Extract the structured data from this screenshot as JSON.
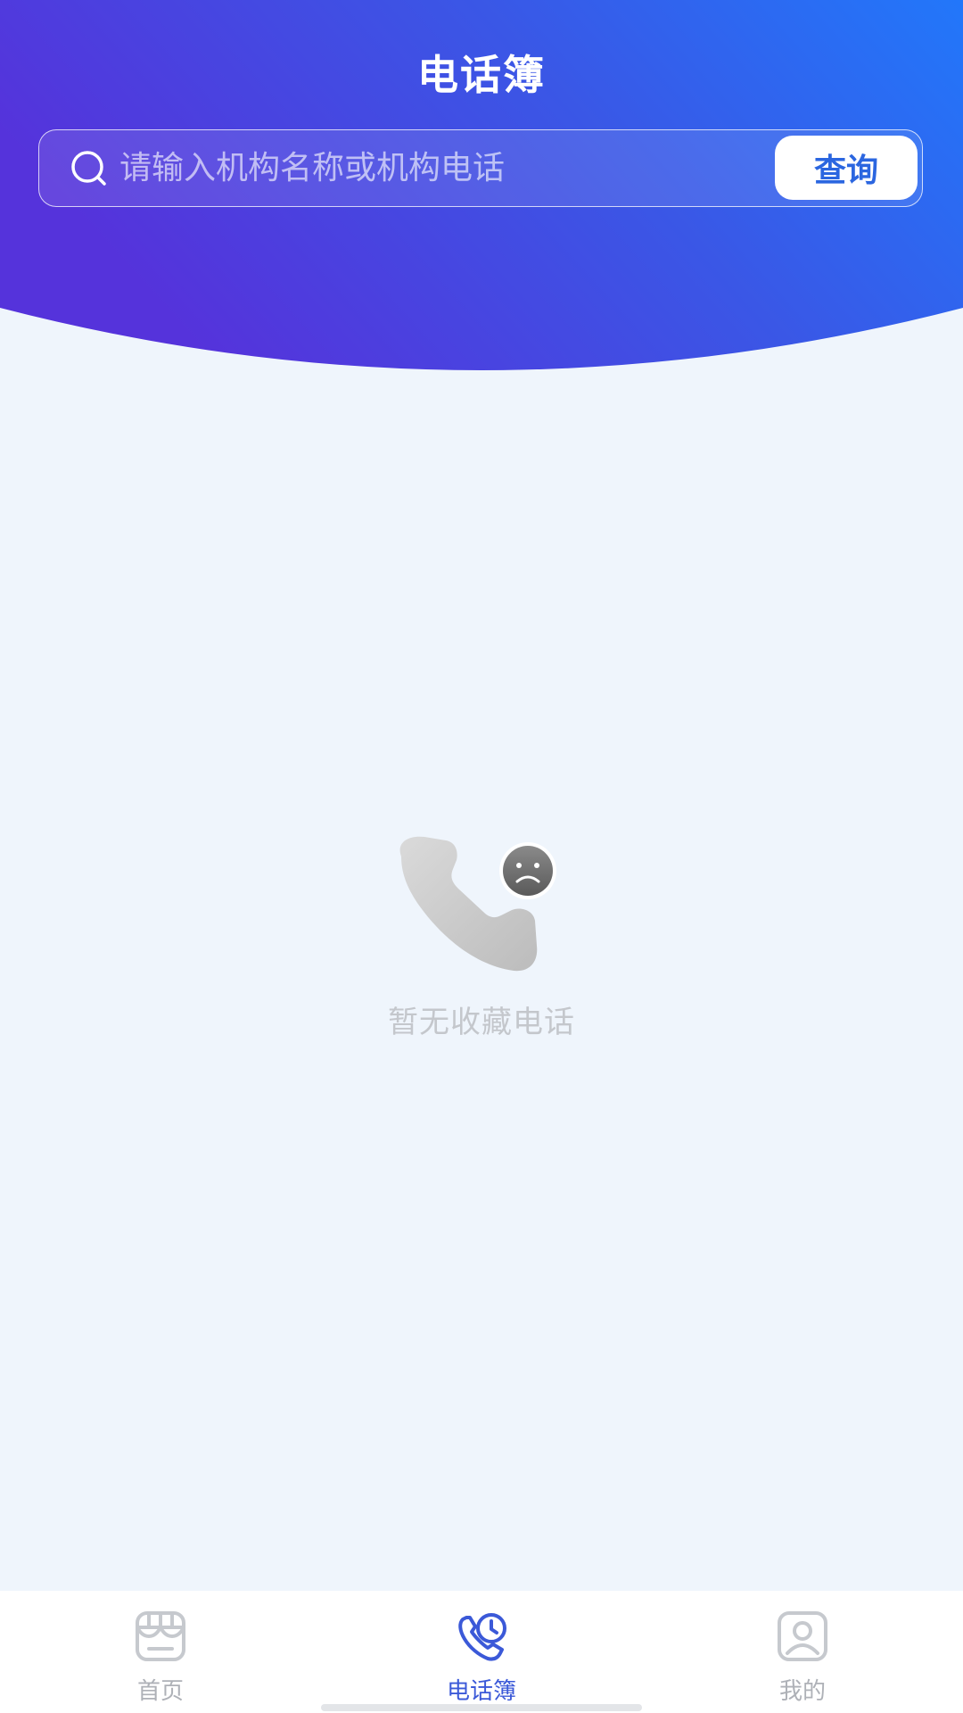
{
  "header": {
    "title": "电话簿"
  },
  "search": {
    "placeholder": "请输入机构名称或机构电话",
    "value": "",
    "button_label": "查询"
  },
  "empty_state": {
    "message": "暂无收藏电话",
    "icon": "phone-sad-icon"
  },
  "tab_bar": {
    "items": [
      {
        "label": "首页",
        "icon": "store-icon",
        "active": false
      },
      {
        "label": "电话簿",
        "icon": "phone-clock-icon",
        "active": true
      },
      {
        "label": "我的",
        "icon": "user-profile-icon",
        "active": false
      }
    ]
  },
  "colors": {
    "header_gradient_start": "#5533db",
    "header_gradient_end": "#2277fa",
    "background": "#eff5fc",
    "accent": "#3b59d8",
    "button_text": "#2b66e0",
    "inactive": "#aeb1b7"
  }
}
